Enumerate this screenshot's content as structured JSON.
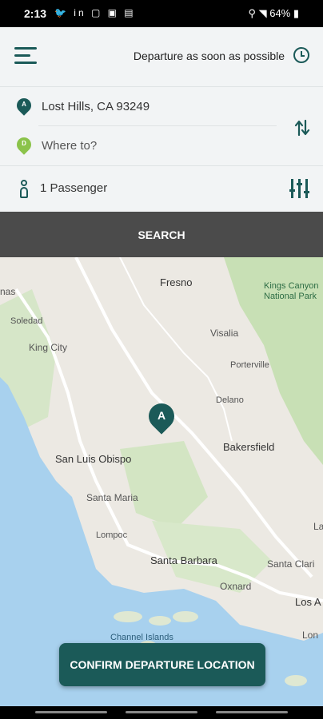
{
  "status_bar": {
    "time": "2:13",
    "notification_icons": "🐦 in ▢ ▣ ▤",
    "right_text": "⚲ ◥ 64% ▮"
  },
  "header": {
    "menu_icon": "hamburger-menu-icon",
    "departure_label": "Departure as soon as possible",
    "clock_icon": "clock-icon"
  },
  "route": {
    "origin_marker": "A",
    "origin": "Lost Hills, CA 93249",
    "destination_marker": "D",
    "destination_placeholder": "Where to?",
    "swap_icon": "swap-icon",
    "marker_color_origin": "#1b5a58",
    "marker_color_destination": "#8bc34a"
  },
  "passengers": {
    "label": "1 Passenger",
    "filter_icon": "filter-sliders-icon"
  },
  "search_button": "SEARCH",
  "map": {
    "pin_label": "A",
    "places": [
      {
        "name": "Fresno"
      },
      {
        "name": "Kings Canyon National Park"
      },
      {
        "name": "nas"
      },
      {
        "name": "Soledad"
      },
      {
        "name": "Visalia"
      },
      {
        "name": "King City"
      },
      {
        "name": "Porterville"
      },
      {
        "name": "Delano"
      },
      {
        "name": "Bakersfield"
      },
      {
        "name": "San Luis Obispo"
      },
      {
        "name": "Santa Maria"
      },
      {
        "name": "Lompoc"
      },
      {
        "name": "Santa Barbara"
      },
      {
        "name": "Santa Clari"
      },
      {
        "name": "Oxnard"
      },
      {
        "name": "Los A"
      },
      {
        "name": "Lon"
      },
      {
        "name": "Channel Islands"
      },
      {
        "name": "La"
      }
    ]
  },
  "confirm_button": "CONFIRM DEPARTURE LOCATION",
  "colors": {
    "accent": "#1b5a58",
    "search_bar": "#4b4b4b",
    "ocean": "#a8d1ee",
    "land": "#ece9e3",
    "vegetation": "#c8e0b5"
  }
}
